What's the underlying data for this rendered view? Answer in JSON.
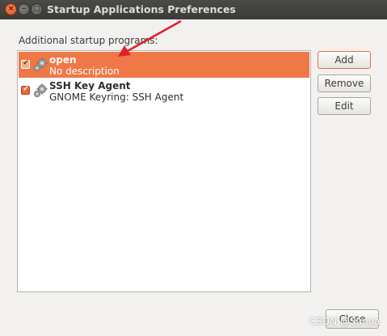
{
  "window": {
    "title": "Startup Applications Preferences",
    "controls": {
      "close_glyph": "×",
      "minimize_glyph": "–",
      "maximize_glyph": "□"
    }
  },
  "section_label": "Additional startup programs:",
  "programs": [
    {
      "name": "open",
      "description": "No description",
      "enabled": true,
      "selected": true,
      "icon": "gears-icon"
    },
    {
      "name": "SSH Key Agent",
      "description": "GNOME Keyring: SSH Agent",
      "enabled": true,
      "selected": false,
      "icon": "gears-icon"
    }
  ],
  "buttons": {
    "add": "Add",
    "remove": "Remove",
    "edit": "Edit",
    "close": "Close"
  },
  "watermark": "CSDN @Sunoa",
  "colors": {
    "selection": "#f07746",
    "checkbox": "#e8683a",
    "annotation_arrow": "#e0202a",
    "titlebar": "#3c3b37"
  }
}
